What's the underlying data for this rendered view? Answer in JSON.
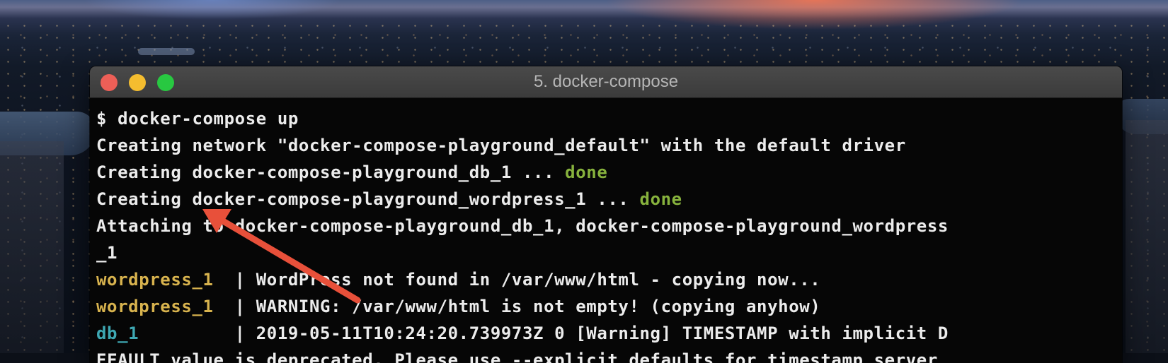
{
  "window": {
    "title": "5. docker-compose"
  },
  "terminal": {
    "lines": [
      {
        "parts": [
          {
            "text": "$ docker-compose up",
            "color": "default"
          }
        ]
      },
      {
        "parts": [
          {
            "text": "Creating network \"docker-compose-playground_default\" with the default driver",
            "color": "default"
          }
        ]
      },
      {
        "parts": [
          {
            "text": "Creating docker-compose-playground_db_1 ... ",
            "color": "default"
          },
          {
            "text": "done",
            "color": "green"
          }
        ]
      },
      {
        "parts": [
          {
            "text": "Creating docker-compose-playground_wordpress_1 ... ",
            "color": "default"
          },
          {
            "text": "done",
            "color": "green"
          }
        ]
      },
      {
        "parts": [
          {
            "text": "Attaching to docker-compose-playground_db_1, docker-compose-playground_wordpress",
            "color": "default"
          }
        ]
      },
      {
        "parts": [
          {
            "text": "_1",
            "color": "default"
          }
        ]
      },
      {
        "parts": [
          {
            "text": "wordpress_1  ",
            "color": "yellow"
          },
          {
            "text": "| WordPress not found in /var/www/html - copying now...",
            "color": "default"
          }
        ]
      },
      {
        "parts": [
          {
            "text": "wordpress_1  ",
            "color": "yellow"
          },
          {
            "text": "| WARNING: /var/www/html is not empty! (copying anyhow)",
            "color": "default"
          }
        ]
      },
      {
        "parts": [
          {
            "text": "db_1         ",
            "color": "cyan"
          },
          {
            "text": "| 2019-05-11T10:24:20.739973Z 0 [Warning] TIMESTAMP with implicit D",
            "color": "default"
          }
        ]
      },
      {
        "parts": [
          {
            "text": "EFAULT value is deprecated. Please use --explicit_defaults_for_timestamp server",
            "color": "default"
          }
        ]
      }
    ]
  },
  "colors": {
    "arrow": "#e8503a",
    "done": "#87b23d",
    "wordpress_prefix": "#d8b34e",
    "db_prefix": "#3ea8b3"
  }
}
